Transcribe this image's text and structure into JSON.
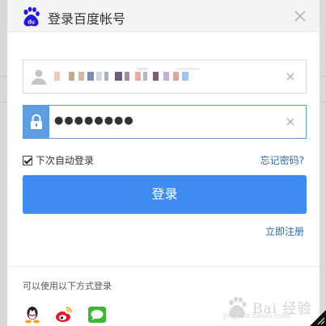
{
  "header": {
    "title": "登录百度帐号",
    "logo_text": "du",
    "logo_icon": "baidu-paw-icon",
    "close_icon": "close-icon"
  },
  "form": {
    "username": {
      "icon": "user-icon",
      "value_colors": [
        "#f2c8b6",
        "#c8a88a",
        "#d6b8a0",
        "#7f8fb8",
        "#cfd9ea",
        "#6e5f78",
        "#a08aa4",
        "#f0a8a0",
        "#b8b6c0",
        "#7a5f70",
        "#c6b1cd",
        "#9bc8ea"
      ],
      "clear_icon": "clear-icon"
    },
    "password": {
      "icon": "lock-icon",
      "value": "●●●●●●●●",
      "clear_icon": "clear-icon"
    },
    "remember_label": "下次自动登录",
    "remember_checked": true,
    "forgot_label": "忘记密码?",
    "login_label": "登录",
    "register_label": "立即注册"
  },
  "other": {
    "label": "可以使用以下方式登录",
    "providers": [
      {
        "name": "qq",
        "icon": "qq-icon"
      },
      {
        "name": "weibo",
        "icon": "weibo-icon"
      },
      {
        "name": "wechat",
        "icon": "chat-icon"
      }
    ]
  },
  "watermark": {
    "text": "Bai 经验",
    "sub": "jingyan.baidu.com"
  },
  "colors": {
    "accent": "#3f8bf0",
    "link": "#2b6ab3",
    "field_focus": "#5b9bd5"
  }
}
